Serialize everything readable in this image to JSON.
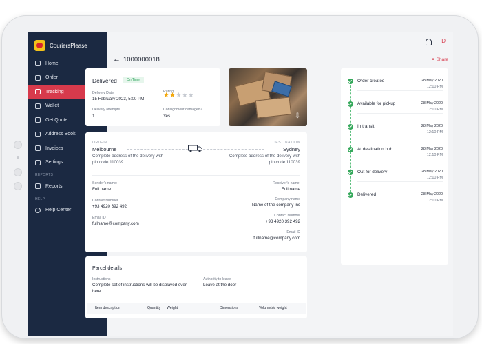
{
  "app": {
    "brand": "CouriersPlease",
    "user_initial": "D"
  },
  "sidebar": {
    "items": [
      {
        "label": "Home",
        "icon": "home-icon"
      },
      {
        "label": "Order",
        "icon": "order-icon"
      },
      {
        "label": "Tracking",
        "icon": "tracking-icon",
        "active": true
      },
      {
        "label": "Wallet",
        "icon": "wallet-icon"
      },
      {
        "label": "Get Quote",
        "icon": "quote-icon"
      },
      {
        "label": "Address Book",
        "icon": "address-book-icon"
      },
      {
        "label": "Invoices",
        "icon": "invoice-icon"
      },
      {
        "label": "Settings",
        "icon": "gear-icon"
      }
    ],
    "reports_section": "REPORTS",
    "reports_item": "Reports",
    "help_section": "HELP",
    "help_item": "Help Center"
  },
  "header": {
    "order_number": "1000000018",
    "share_label": "Share"
  },
  "status": {
    "title": "Delivered",
    "badge": "On Time",
    "delivery_date_label": "Delivery Date",
    "delivery_date": "15 February 2023, 5:00 PM",
    "rating_label": "Rating",
    "rating": 2,
    "rating_max": 5,
    "attempts_label": "Delivery attempts",
    "attempts": "1",
    "damaged_label": "Consignment damaged?",
    "damaged": "Yes"
  },
  "route": {
    "origin_label": "ORIGIN",
    "origin_city": "Melbourne",
    "origin_address": "Complete address of the delivery with pin code 110039",
    "destination_label": "DESTINATION",
    "destination_city": "Sydney",
    "destination_address": "Complete address of the delivery with pin code 110039"
  },
  "sender": {
    "name_label": "Sender's name:",
    "name": "Full name",
    "phone_label": "Contact Number",
    "phone": "+93 4920 392 492",
    "email_label": "Email ID",
    "email": "fullname@company.com"
  },
  "receiver": {
    "name_label": "Receiver's name:",
    "name": "Full name",
    "company_label": "Company name",
    "company": "Name of the company inc",
    "phone_label": "Contact Number",
    "phone": "+93 4920 392 492",
    "email_label": "Email ID",
    "email": "fullname@company.com"
  },
  "parcel": {
    "title": "Parcel details",
    "instructions_label": "Instructions",
    "instructions": "Complete set of instructions will be displayed over here",
    "authority_label": "Authority to leave",
    "authority": "Leave at the door",
    "columns": [
      "Item description",
      "Quantity",
      "Weight",
      "Dimensions",
      "Volumetric weight"
    ]
  },
  "timeline": [
    {
      "title": "Order created",
      "date": "28 May 2020",
      "time": "12:10 PM"
    },
    {
      "title": "Available for pickup",
      "date": "28 May 2020",
      "time": "12:10 PM"
    },
    {
      "title": "In transit",
      "date": "28 May 2020",
      "time": "12:10 PM"
    },
    {
      "title": "At destination hub",
      "date": "28 May 2020",
      "time": "12:10 PM"
    },
    {
      "title": "Out for delivery",
      "date": "28 May 2020",
      "time": "12:10 PM"
    },
    {
      "title": "Delivered",
      "date": "28 May 2020",
      "time": "12:10 PM"
    }
  ],
  "colors": {
    "sidebar": "#1b2942",
    "accent": "#d73a4c",
    "success": "#35a85b",
    "star": "#f2a80d"
  }
}
